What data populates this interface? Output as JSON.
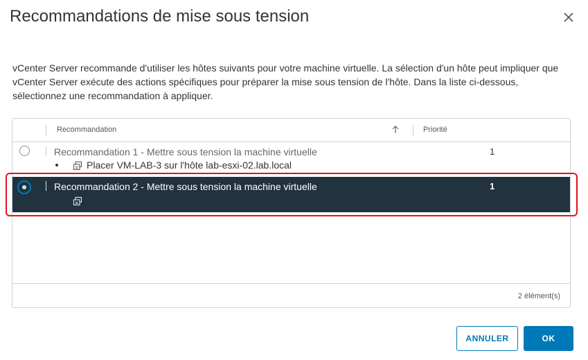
{
  "dialog": {
    "title": "Recommandations de mise sous tension",
    "description": "vCenter Server recommande d'utiliser les hôtes suivants pour votre machine virtuelle. La sélection d'un hôte peut impliquer que vCenter Server exécute des actions spécifiques pour préparer la mise sous tension de l'hôte. Dans la liste ci-dessous, sélectionnez une recommandation à appliquer."
  },
  "grid": {
    "columns": [
      "Recommandation",
      "Priorité"
    ],
    "rows": [
      {
        "title": "Recommandation 1 - Mettre sous tension la machine virtuelle",
        "priority": "1",
        "action": "Placer VM-LAB-3 sur l'hôte lab-esxi-02.lab.local",
        "selected": false
      },
      {
        "title": "Recommandation 2 - Mettre sous tension la machine virtuelle",
        "priority": "1",
        "action": "",
        "selected": true
      }
    ],
    "footer_count": "2 élément(s)"
  },
  "buttons": {
    "cancel": "ANNULER",
    "ok": "OK"
  },
  "icons": {
    "close": "close-icon",
    "sort": "sort-ascending-icon",
    "vm": "virtual-machine-icon"
  },
  "colors": {
    "accent": "#0079b8",
    "selected_row": "#21333f",
    "highlight": "#e0141e"
  }
}
